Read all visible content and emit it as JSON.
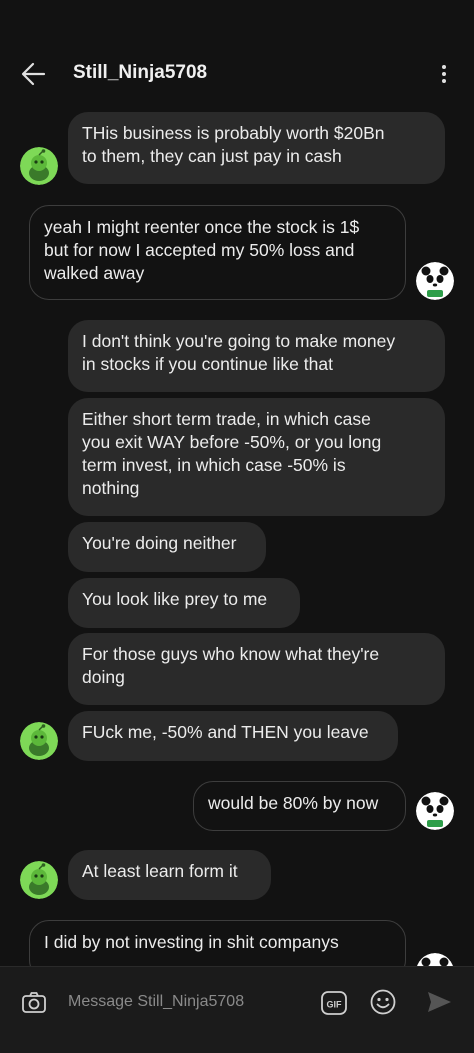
{
  "header": {
    "title": "Still_Ninja5708",
    "back_icon": "arrow-left-icon",
    "menu_icon": "more-vertical-icon"
  },
  "messages": [
    {
      "sender": "them",
      "text_lines": [
        "THis business is probably worth $20Bn",
        "to them, they can just pay in cash"
      ]
    },
    {
      "sender": "me",
      "text_lines": [
        "yeah I might reenter once the stock is 1$",
        "but for now I accepted my 50% loss and",
        "walked away"
      ]
    },
    {
      "sender": "them",
      "text_lines": [
        "I don't think you're going to make money",
        "in stocks if you continue like that"
      ]
    },
    {
      "sender": "them",
      "text_lines": [
        "Either short term trade, in which case",
        "you exit WAY before -50%, or you long",
        "term invest, in which case -50% is",
        "nothing"
      ]
    },
    {
      "sender": "them",
      "text_lines": [
        "You're doing neither"
      ]
    },
    {
      "sender": "them",
      "text_lines": [
        "You look like prey to me"
      ]
    },
    {
      "sender": "them",
      "text_lines": [
        "For those guys who know what they're",
        "doing"
      ]
    },
    {
      "sender": "them",
      "text_lines": [
        "FUck me, -50% and THEN you leave"
      ]
    },
    {
      "sender": "me",
      "text_lines": [
        "would be 80% by now"
      ]
    },
    {
      "sender": "them",
      "text_lines": [
        "At least learn form it"
      ]
    },
    {
      "sender": "me",
      "text_lines": [
        "I did by not investing in shit companys"
      ]
    }
  ],
  "composer": {
    "placeholder": "Message Still_Ninja5708",
    "camera_icon": "camera-icon",
    "gif_label": "GIF",
    "emoji_icon": "emoji-icon",
    "send_icon": "send-icon"
  },
  "colors": {
    "background": "#121212",
    "bubble_in": "#2a2a2a",
    "bubble_out_border": "#3d3d3d",
    "avatar_green": "#7ed957"
  }
}
